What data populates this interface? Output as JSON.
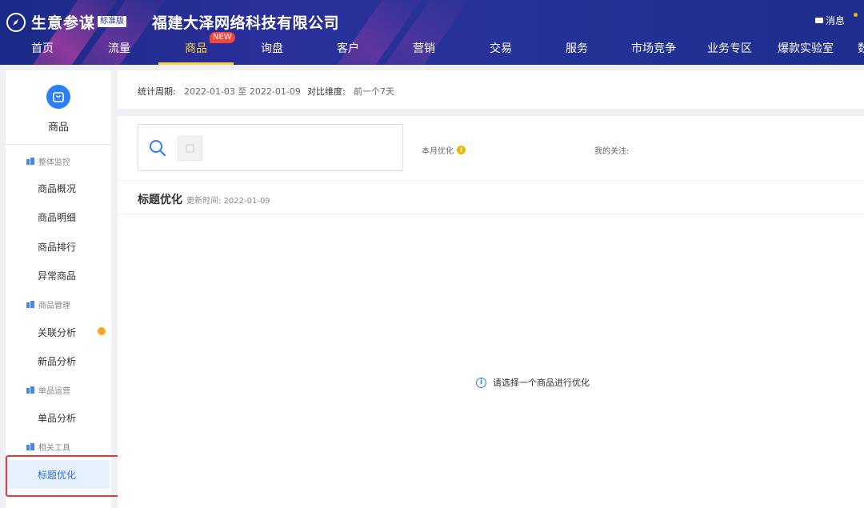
{
  "header": {
    "brand": "生意参谋",
    "edition": "标准版",
    "company": "福建大泽网络科技有限公司",
    "message_label": "消息",
    "new_badge": "NEW",
    "nav": [
      "首页",
      "流量",
      "商品",
      "询盘",
      "客户",
      "营销",
      "交易",
      "服务",
      "市场竞争",
      "业务专区",
      "爆款实验室",
      "数"
    ],
    "active_nav": "商品"
  },
  "sidebar": {
    "title": "商品",
    "groups": [
      {
        "label": "整体监控",
        "items": [
          "商品概况",
          "商品明细",
          "商品排行",
          "异常商品"
        ]
      },
      {
        "label": "商品管理",
        "items": [
          "关联分析",
          "新品分析"
        ]
      },
      {
        "label": "单品运营",
        "items": [
          "单品分析"
        ]
      },
      {
        "label": "相关工具",
        "items": [
          "标题优化"
        ]
      }
    ],
    "active_item": "标题优化",
    "badge_color": "#f5a623"
  },
  "period": {
    "label": "统计周期:",
    "value": "2022-01-03 至 2022-01-09",
    "compare_label": "对比维度:",
    "compare_value": "前一个7天"
  },
  "main": {
    "month_optimize": "本月优化",
    "my_follow": "我的关注:",
    "section_title": "标题优化",
    "update_time": "更新时间: 2022-01-09",
    "empty_hint": "请选择一个商品进行优化"
  },
  "colors": {
    "header_bg": "#1f2d8e",
    "accent_blue": "#2d7ff9",
    "active_nav": "#ffd23c",
    "highlight_box": "#e53935"
  }
}
